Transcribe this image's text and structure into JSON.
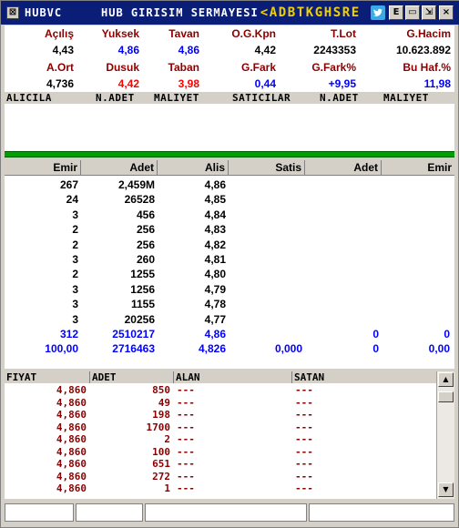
{
  "title": {
    "code": "HUBVC",
    "name": "HUB GIRISIM SERMAYESI",
    "letters": [
      "<",
      "A",
      "D",
      "B",
      "T",
      "K",
      "G",
      "H",
      "S",
      "R",
      "E"
    ],
    "icon_names": [
      "close-icon",
      "twitter-icon",
      "info-icon",
      "minimize-icon",
      "restore-icon",
      "close-icon"
    ],
    "btn_e": "E",
    "btn_min": "▭",
    "btn_restore": "⇲",
    "btn_close": "×",
    "sys_icon": "⊠"
  },
  "stats": {
    "row1_labels": [
      "Açılış",
      "Yuksek",
      "Tavan",
      "O.G.Kpn",
      "T.Lot",
      "G.Hacim"
    ],
    "row1_values": [
      "4,43",
      "4,86",
      "4,86",
      "4,42",
      "2243353",
      "10.623.892"
    ],
    "row2_labels": [
      "A.Ort",
      "Dusuk",
      "Taban",
      "G.Fark",
      "G.Fark%",
      "Bu Haf.%"
    ],
    "row2_values": [
      "4,736",
      "4,42",
      "3,98",
      "0,44",
      "+9,95",
      "11,98"
    ],
    "colors": {
      "label": "#8b0000",
      "up": "#0000ff",
      "down": "#ff0000",
      "min": "#008000",
      "neutral": "#000000"
    }
  },
  "orderbook_header": [
    "ALICILA",
    "N.ADET",
    "MALIYET",
    "SATICILAR",
    "N.ADET",
    "MALIYET"
  ],
  "depth": {
    "headers": [
      "Emir",
      "Adet",
      "Alis",
      "Satis",
      "Adet",
      "Emir"
    ],
    "rows": [
      [
        "267",
        "2,459M",
        "4,86",
        "",
        "",
        ""
      ],
      [
        "24",
        "26528",
        "4,85",
        "",
        "",
        ""
      ],
      [
        "3",
        "456",
        "4,84",
        "",
        "",
        ""
      ],
      [
        "2",
        "256",
        "4,83",
        "",
        "",
        ""
      ],
      [
        "2",
        "256",
        "4,82",
        "",
        "",
        ""
      ],
      [
        "3",
        "260",
        "4,81",
        "",
        "",
        ""
      ],
      [
        "2",
        "1255",
        "4,80",
        "",
        "",
        ""
      ],
      [
        "3",
        "1256",
        "4,79",
        "",
        "",
        ""
      ],
      [
        "3",
        "1155",
        "4,78",
        "",
        "",
        ""
      ],
      [
        "3",
        "20256",
        "4,77",
        "",
        "",
        ""
      ]
    ],
    "total_row": [
      "312",
      "2510217",
      "4,86",
      "",
      "0",
      "0"
    ],
    "avg_row": [
      "100,00",
      "2716463",
      "4,826",
      "0,000",
      "0",
      "0,00"
    ]
  },
  "trades": {
    "headers": [
      "FIYAT",
      "ADET",
      "ALAN",
      "SATAN"
    ],
    "rows": [
      [
        "4,860",
        "850",
        "---",
        "---"
      ],
      [
        "4,860",
        "49",
        "---",
        "---"
      ],
      [
        "4,860",
        "198",
        "---",
        "---"
      ],
      [
        "4,860",
        "1700",
        "---",
        "---"
      ],
      [
        "4,860",
        "2",
        "---",
        "---"
      ],
      [
        "4,860",
        "100",
        "---",
        "---"
      ],
      [
        "4,860",
        "651",
        "---",
        "---"
      ],
      [
        "4,860",
        "272",
        "---",
        "---"
      ],
      [
        "4,860",
        "1",
        "---",
        "---"
      ]
    ],
    "scroll_up": "▲",
    "scroll_down": "▼"
  },
  "statusbar": [
    "",
    "",
    "",
    ""
  ]
}
